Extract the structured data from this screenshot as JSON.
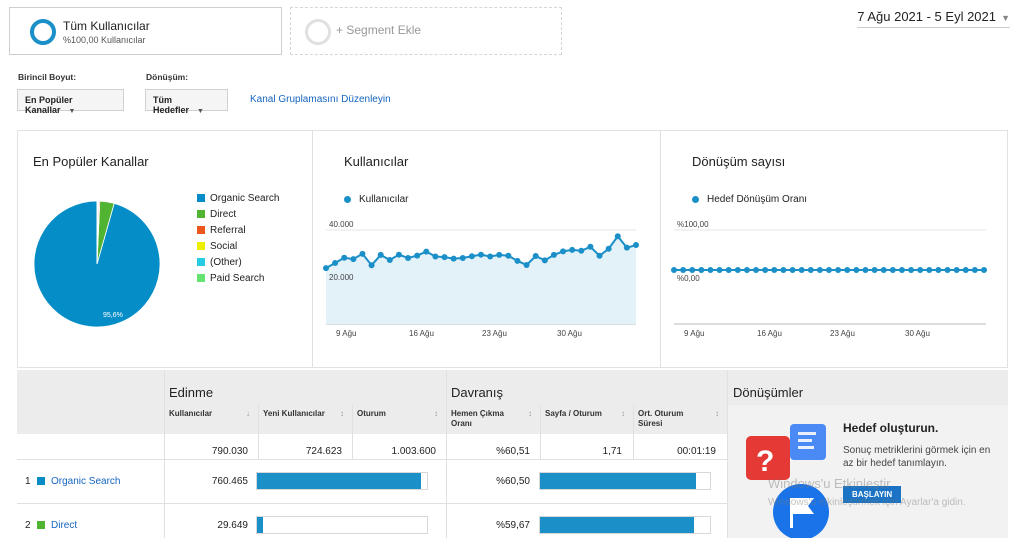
{
  "segments": {
    "active": {
      "name": "Tüm Kullanıcılar",
      "sub": "%100,00 Kullanıcılar"
    },
    "add_label": "+ Segment Ekle"
  },
  "date_range": "7 Ağu 2021 - 5 Eyl 2021",
  "controls": {
    "primary_dimension_label": "Birincil Boyut:",
    "primary_dimension_value": "En Popüler Kanallar",
    "conversion_label": "Dönüşüm:",
    "conversion_value": "Tüm Hedefler",
    "edit_grouping_link": "Kanal Gruplamasını Düzenleyin"
  },
  "pie_panel": {
    "title": "En Popüler Kanallar",
    "legend": [
      {
        "label": "Organic Search",
        "color": "#058dc7"
      },
      {
        "label": "Direct",
        "color": "#50b432"
      },
      {
        "label": "Referral",
        "color": "#ed561b"
      },
      {
        "label": "Social",
        "color": "#edef00"
      },
      {
        "label": "(Other)",
        "color": "#24cbe5"
      },
      {
        "label": "Paid Search",
        "color": "#64e572"
      }
    ],
    "slice_label": "95,6%"
  },
  "users_panel": {
    "title": "Kullanıcılar",
    "series_label": "Kullanıcılar",
    "y_ticks": [
      "40.000",
      "20.000"
    ],
    "x_ticks": [
      "9 Ağu",
      "16 Ağu",
      "23 Ağu",
      "30 Ağu"
    ]
  },
  "conv_panel": {
    "title": "Dönüşüm sayısı",
    "series_label": "Hedef Dönüşüm Oranı",
    "y_ticks": [
      "%100,00",
      "%0,00"
    ],
    "x_ticks": [
      "9 Ağu",
      "16 Ağu",
      "23 Ağu",
      "30 Ağu"
    ]
  },
  "chart_data": [
    {
      "type": "pie",
      "categories": [
        "Organic Search",
        "Direct",
        "Referral",
        "Social",
        "(Other)",
        "Paid Search"
      ],
      "values": [
        95.6,
        3.7,
        0.3,
        0.2,
        0.1,
        0.1
      ],
      "title": "En Popüler Kanallar"
    },
    {
      "type": "area",
      "title": "Kullanıcılar",
      "series": [
        {
          "name": "Kullanıcılar",
          "values": [
            25500,
            27800,
            30200,
            29600,
            32000,
            26800,
            31500,
            29200,
            31600,
            30100,
            31200,
            33000,
            30800,
            30500,
            29800,
            30100,
            30900,
            31600,
            30800,
            31500,
            31100,
            28800,
            26900,
            31000,
            29000,
            31500,
            33100,
            33800,
            33400,
            35200,
            31100,
            34300,
            40000,
            34800,
            36000
          ]
        }
      ],
      "ylim": [
        0,
        45000
      ]
    },
    {
      "type": "line",
      "title": "Dönüşüm sayısı",
      "series": [
        {
          "name": "Hedef Dönüşüm Oranı",
          "values": [
            0,
            0,
            0,
            0,
            0,
            0,
            0,
            0,
            0,
            0,
            0,
            0,
            0,
            0,
            0,
            0,
            0,
            0,
            0,
            0,
            0,
            0,
            0,
            0,
            0,
            0,
            0,
            0,
            0,
            0,
            0,
            0,
            0,
            0,
            0
          ]
        }
      ],
      "ylim": [
        0,
        100
      ]
    }
  ],
  "table": {
    "groups": {
      "acquisition": "Edinme",
      "behavior": "Davranış",
      "conversions": "Dönüşümler"
    },
    "headers": {
      "users": "Kullanıcılar",
      "new_users": "Yeni Kullanıcılar",
      "sessions": "Oturum",
      "bounce_rate": "Hemen Çıkma Oranı",
      "pages_per_session": "Sayfa / Oturum",
      "avg_session_duration": "Ort. Oturum Süresi"
    },
    "totals": {
      "users": "790.030",
      "new_users": "724.623",
      "sessions": "1.003.600",
      "bounce_rate": "%60,51",
      "pages_per_session": "1,71",
      "avg_session_duration": "00:01:19"
    },
    "rows": [
      {
        "num": "1",
        "channel": "Organic Search",
        "color": "#058dc7",
        "users": "760.465",
        "users_fraction": 0.963,
        "bounce_rate": "%60,50",
        "bounce_fraction": 0.605
      },
      {
        "num": "2",
        "channel": "Direct",
        "color": "#50b432",
        "users": "29.649",
        "users_fraction": 0.038,
        "bounce_rate": "%59,67",
        "bounce_fraction": 0.597
      }
    ]
  },
  "goal_promo": {
    "title": "Hedef oluşturun.",
    "desc_line1": "Sonuç metriklerini görmek için en",
    "desc_line2": "az bir hedef tanımlayın.",
    "button": "BAŞLAYIN"
  },
  "watermark": {
    "line1": "Windows'u Etkinleştir",
    "line2": "Windows'u etkinleştirmek için Ayarlar'a gidin."
  }
}
